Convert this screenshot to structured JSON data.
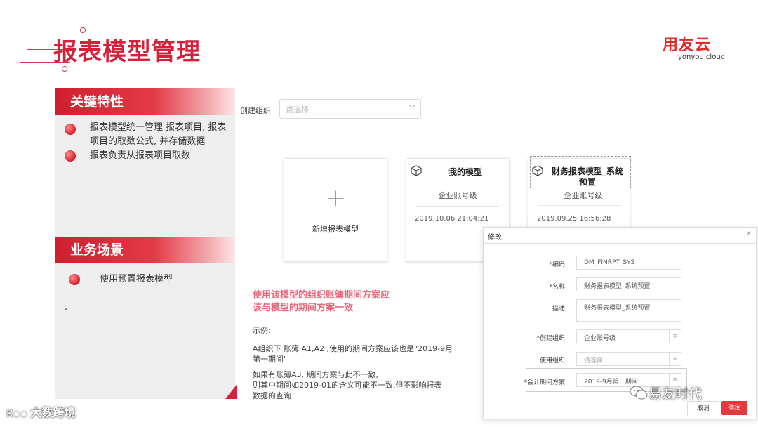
{
  "header": {
    "title": "报表模型管理",
    "logo_brand": "用友云",
    "logo_sub": "yonyou cloud"
  },
  "left_panel": {
    "section1_title": "关键特性",
    "section1_items": [
      "报表模型统一管理 报表项目, 报表",
      "项目的取数公式, 并存储数据",
      "报表负责从报表项目取数"
    ],
    "section2_title": "业务场景",
    "section2_items": [
      "使用预置报表模型"
    ],
    "dot": "."
  },
  "main": {
    "org_label": "创建组织",
    "org_placeholder": "请选择",
    "cards": {
      "new": {
        "label": "新增报表模型"
      },
      "my": {
        "title": "我的模型",
        "level": "企业账号级",
        "date": "2019.10.06 21:04:21"
      },
      "sys": {
        "title_line1": "财务报表模型_系统",
        "title_line2": "预置",
        "level": "企业账号级",
        "date": "2019.09.25 16:56:28"
      }
    },
    "notice_line1": "使用该模型的组织账簿期间方案应",
    "notice_line2": "该与模型的期间方案一致",
    "example_label": "示例:",
    "example_p1_line1": "A组织下 账簿 A1,A2 ,使用的期间方案应该也是\"2019-9月",
    "example_p1_line2": "第一期间\"",
    "example_p2_line1": "如果有账簿A3, 期间方案与此不一致,",
    "example_p2_line2": "则其中期间如2019-01的含义可能不一致,但不影响报表",
    "example_p2_line3": "数据的查询"
  },
  "dialog": {
    "title": "修改",
    "close": "×",
    "fields": {
      "code_label": "*编码",
      "code_value": "DM_FINRPT_SYS",
      "name_label": "*名称",
      "name_value": "财务报表模型_系统预置",
      "desc_label": "描述",
      "desc_value": "财务报表模型_系统预置",
      "org_label": "*创建组织",
      "org_value": "企业账号级",
      "use_org_label": "使用组织",
      "use_org_placeholder": "请选择",
      "period_label": "*会计期间方案",
      "period_value": "2019-9月第一期间"
    },
    "cancel": "取消",
    "ok": "确定"
  },
  "watermarks": {
    "left": "大数跨境",
    "right": "易友时代"
  },
  "colors": {
    "brand_red": "#d6213a",
    "notice_pink": "#e8677b",
    "ok_button": "#e4393c"
  }
}
